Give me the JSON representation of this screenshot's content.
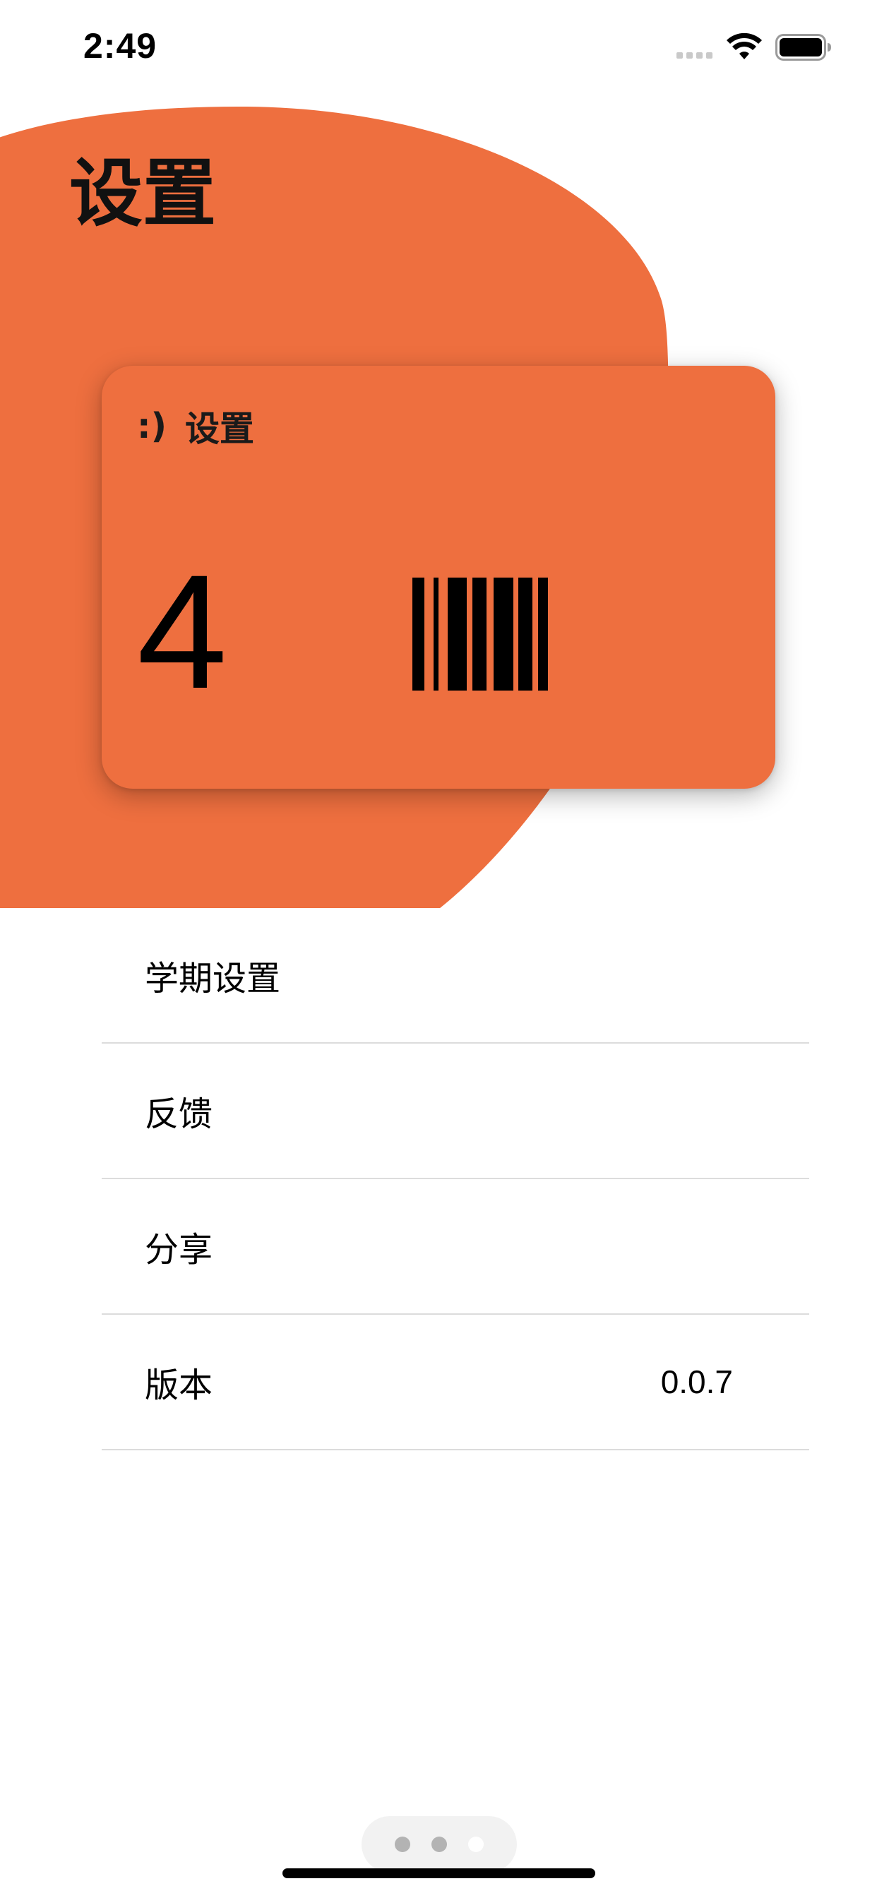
{
  "status_bar": {
    "time": "2:49",
    "signal_icon": "signal-dots-icon",
    "wifi_icon": "wifi-icon",
    "battery_icon": "battery-full-icon"
  },
  "header": {
    "title": "设置",
    "blob_color": "#ee6f3f"
  },
  "card": {
    "emoticon": ":)",
    "label": "设置",
    "number": "4",
    "barcode_icon": "barcode-icon",
    "background": "#ee6f3f"
  },
  "settings": {
    "items": [
      {
        "label": "学期设置",
        "value": ""
      },
      {
        "label": "反馈",
        "value": ""
      },
      {
        "label": "分享",
        "value": ""
      },
      {
        "label": "版本",
        "value": "0.0.7"
      }
    ]
  },
  "page_indicator": {
    "total": 3,
    "active_index": 2
  }
}
